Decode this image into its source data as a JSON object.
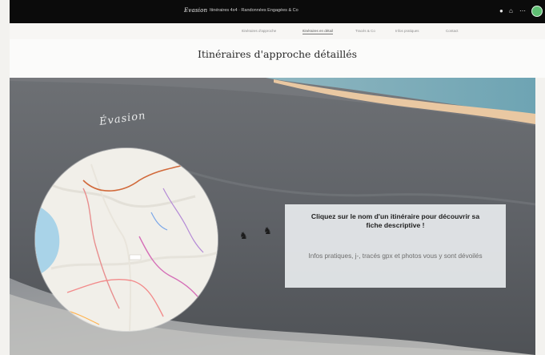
{
  "header": {
    "brand": "Evasion",
    "subtitle": "Itinéraires 4x4 · Randonnées Engagées & Co",
    "icons": [
      "notification-dot-icon",
      "user-icon",
      "more-icon",
      "avatar"
    ]
  },
  "nav": {
    "tabs": [
      {
        "label": "Itinéraires d'approche",
        "active": false
      },
      {
        "label": "Itinéraires en détail",
        "active": true
      },
      {
        "label": "Tracés & Co",
        "active": false
      },
      {
        "label": "Infos pratiques",
        "active": false
      },
      {
        "label": "Contact",
        "active": false
      }
    ]
  },
  "page": {
    "title": "Itinéraires d'approche détaillés"
  },
  "hero": {
    "signature": "Evasion",
    "card_heading": "Cliquez sur le nom d'un itinéraire pour découvrir sa fiche descriptive !",
    "card_body": "Infos pratiques, j-, tracés gpx et photos vous y sont dévoilés"
  },
  "colors": {
    "topbar": "#0b0b0b",
    "avatar": "#5fbf73",
    "card": "#ebeef1"
  }
}
